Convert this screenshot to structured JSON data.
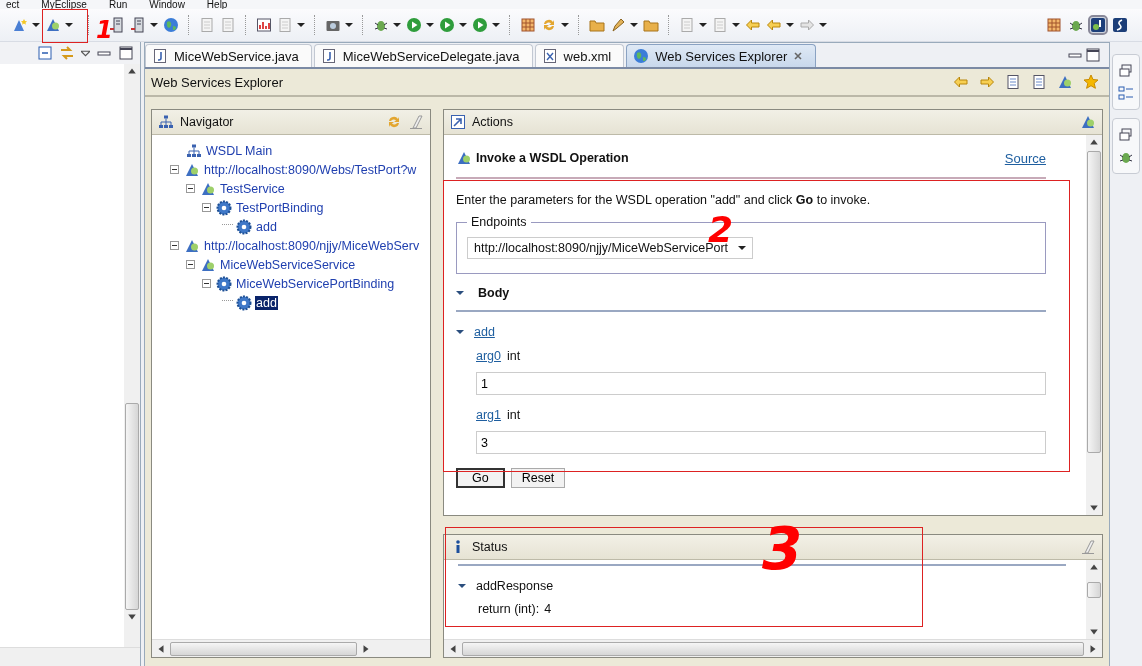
{
  "menu": [
    {
      "label": "ect"
    },
    {
      "label": "MyEclipse"
    },
    {
      "label": "Run"
    },
    {
      "label": "Window"
    },
    {
      "label": "Help"
    }
  ],
  "editor_tabs": [
    {
      "label": "MiceWebService.java",
      "kind": "java",
      "selected": false
    },
    {
      "label": "MiceWebServiceDelegate.java",
      "kind": "java",
      "selected": false
    },
    {
      "label": "web.xml",
      "kind": "xml",
      "selected": false
    },
    {
      "label": "Web Services Explorer",
      "kind": "explorer",
      "selected": true
    }
  ],
  "explorer_title": "Web Services Explorer",
  "navigator": {
    "title": "Navigator",
    "tree": [
      {
        "label": "WSDL Main",
        "kind": "main",
        "selected": false
      },
      {
        "label": "http://localhost:8090/Webs/TestPort?w",
        "kind": "wsdl",
        "selected": false,
        "expanded": true,
        "children": [
          {
            "label": "TestService",
            "kind": "service",
            "selected": false,
            "expanded": true,
            "children": [
              {
                "label": "TestPortBinding",
                "kind": "binding",
                "selected": false,
                "expanded": true,
                "children": [
                  {
                    "label": "add",
                    "kind": "operation",
                    "selected": false
                  }
                ]
              }
            ]
          }
        ]
      },
      {
        "label": "http://localhost:8090/njjy/MiceWebServ",
        "kind": "wsdl",
        "selected": false,
        "expanded": true,
        "children": [
          {
            "label": "MiceWebServiceService",
            "kind": "service",
            "selected": false,
            "expanded": true,
            "children": [
              {
                "label": "MiceWebServicePortBinding",
                "kind": "binding",
                "selected": false,
                "expanded": true,
                "children": [
                  {
                    "label": "add",
                    "kind": "operation",
                    "selected": true
                  }
                ]
              }
            ]
          }
        ]
      }
    ]
  },
  "actions": {
    "title": "Actions",
    "heading": "Invoke a WSDL Operation",
    "source_link": "Source",
    "intro": "Enter the parameters for the WSDL operation \"add\" and click **Go** to invoke.",
    "endpoints_label": "Endpoints",
    "endpoint": "http://localhost:8090/njjy/MiceWebServicePort",
    "body_title": "Body",
    "body_expanded": true,
    "operation": "add",
    "operation_expanded": true,
    "params": [
      {
        "name": "arg0",
        "type": "int",
        "value": "1"
      },
      {
        "name": "arg1",
        "type": "int",
        "value": "3"
      }
    ],
    "buttons": [
      {
        "label": "Go",
        "kind": "default"
      },
      {
        "label": "Reset",
        "kind": "normal"
      }
    ]
  },
  "status": {
    "title": "Status",
    "response": "addResponse",
    "expanded": true,
    "result_label": "return (int):",
    "result_value": "4"
  },
  "annotations": [
    {
      "label": "1"
    },
    {
      "label": "2"
    },
    {
      "label": "3"
    }
  ]
}
